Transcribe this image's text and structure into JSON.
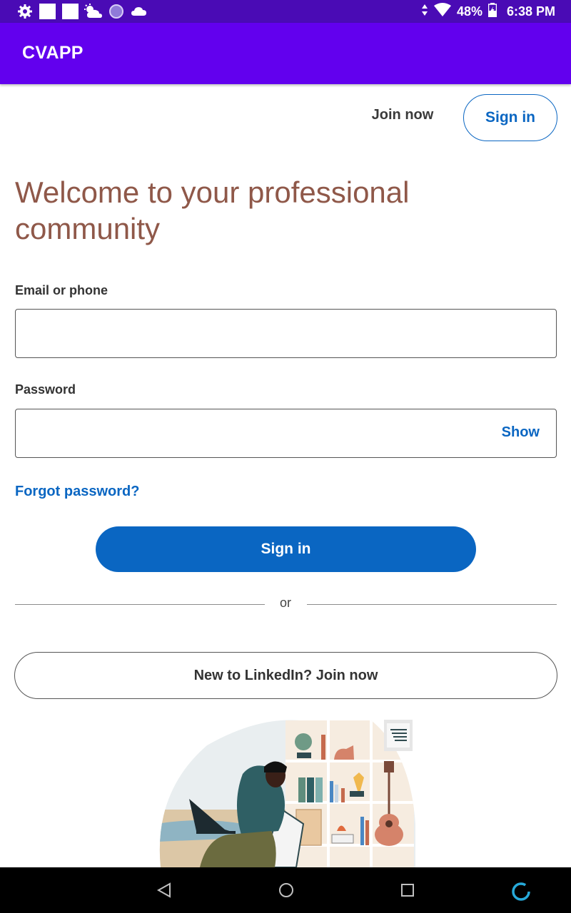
{
  "status_bar": {
    "battery": "48%",
    "time": "6:38 PM",
    "icons": [
      "settings-icon",
      "square-icon",
      "square-icon",
      "weather-icon",
      "circle-icon",
      "cloud-icon",
      "signal-arrows-icon",
      "wifi-icon",
      "battery-icon"
    ]
  },
  "app_bar": {
    "title": "CVAPP"
  },
  "header": {
    "join_label": "Join now",
    "signin_label": "Sign in"
  },
  "headline": "Welcome to your professional community",
  "form": {
    "email_label": "Email or phone",
    "email_value": "",
    "password_label": "Password",
    "password_value": "",
    "show_label": "Show",
    "forgot_label": "Forgot password?",
    "signin_label": "Sign in",
    "or_label": "or",
    "join_label": "New to LinkedIn? Join now"
  },
  "nav_bar": {
    "icons": [
      "back-icon",
      "home-icon",
      "recents-icon",
      "assistant-icon"
    ]
  },
  "colors": {
    "status_bar": "#4a0bb5",
    "app_bar": "#6200ee",
    "primary": "#0a66c2",
    "headline": "#8f5849"
  }
}
